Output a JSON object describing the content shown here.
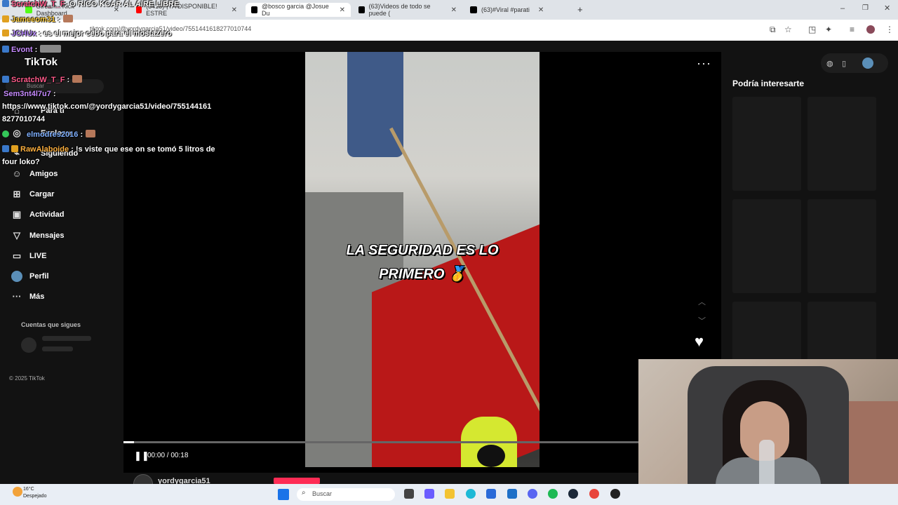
{
  "browser": {
    "tabs": [
      {
        "label": "Stream - Kick Dashboard",
        "color": "#53fc18"
      },
      {
        "label": "(3418) ¡YA DISPONIBLE! ESTRE",
        "color": "#ff0000"
      },
      {
        "label": "@bosco garcia @Josue Du",
        "color": "#000000"
      },
      {
        "label": "(63)Videos de todo se puede (",
        "color": "#000000"
      },
      {
        "label": "(63)#Viral #parati",
        "color": "#000000"
      }
    ],
    "url": "tiktok.com/@yordygarcia51/video/7551441618277010744"
  },
  "sidebar": {
    "search_placeholder": "Buscar",
    "items": [
      {
        "label": "Para ti",
        "icon": "home-icon"
      },
      {
        "label": "Explorar",
        "icon": "compass-icon"
      },
      {
        "label": "Siguiendo",
        "icon": "following-icon"
      },
      {
        "label": "Amigos",
        "icon": "friends-icon"
      },
      {
        "label": "Cargar",
        "icon": "upload-icon"
      },
      {
        "label": "Actividad",
        "icon": "activity-icon"
      },
      {
        "label": "Mensajes",
        "icon": "messages-icon"
      },
      {
        "label": "LIVE",
        "icon": "live-icon"
      },
      {
        "label": "Perfil",
        "icon": "profile-icon"
      },
      {
        "label": "Más",
        "icon": "more-icon"
      }
    ],
    "following_title": "Cuentas que sigues",
    "copyright": "© 2025 TikTok"
  },
  "player": {
    "caption_line1": "LA SEGURIDAD ES LO",
    "caption_line2": "PRIMERO 🥇",
    "time": "00:00 / 00:18",
    "progress": 0.02,
    "author": "yordygarcia51",
    "more_icon": "ellipsis-icon"
  },
  "right_panel": {
    "title": "Podría interesarte"
  },
  "chat": [
    {
      "user": "ScratchW_T_F",
      "color": "#ff5b8a",
      "text": "O RICO KCAR AL AIRE LIBRE"
    },
    {
      "user": "Jameeom31",
      "color": "#ffcf3f",
      "text": ""
    },
    {
      "user": "JCHUx",
      "color": "#b98cff",
      "text": "es el mejor cebo para el mostazero"
    },
    {
      "user": "Evont",
      "color": "#c78bff",
      "text": ""
    },
    {
      "user": "ScratchW_T_F",
      "color": "#ff5b8a",
      "text": ""
    },
    {
      "user": "Sem3nt4l7u7",
      "color": "#c78bff",
      "text": ""
    },
    {
      "user": "",
      "color": "#ffffff",
      "text": "https://www.tiktok.com/@yordygarcia51/video/755144161"
    },
    {
      "user": "",
      "color": "#ffffff",
      "text": "8277010744"
    },
    {
      "user": "elmodres2016",
      "color": "#7fb0ff",
      "text": ""
    },
    {
      "user": "RawAlaboide",
      "color": "#ffb13f",
      "text": "!s viste que ese on se tomó 5 litros de"
    },
    {
      "user": "",
      "color": "#ffffff",
      "text": "four loko?"
    }
  ],
  "taskbar": {
    "temperature": "16°C",
    "weather": "Despejado",
    "search": "Buscar"
  }
}
